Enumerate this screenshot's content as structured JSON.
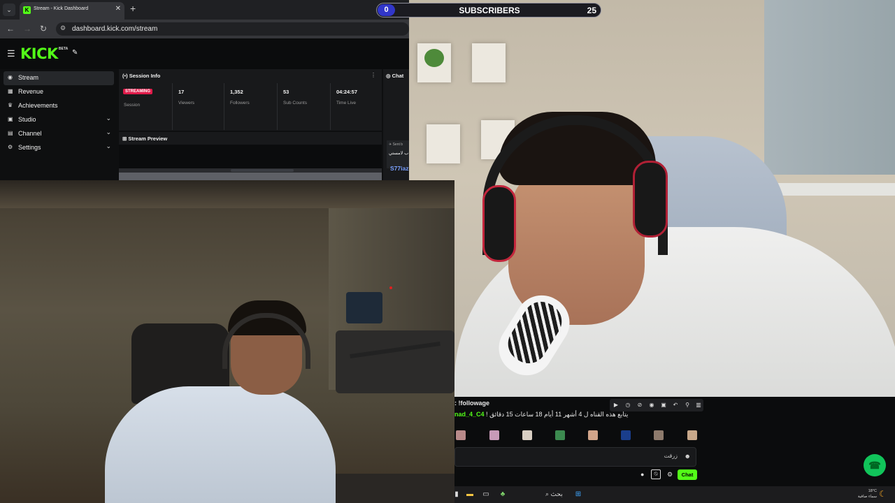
{
  "browser": {
    "tab_title": "Stream - Kick Dashboard",
    "tab_close": "✕",
    "new_tab": "+",
    "url": "dashboard.kick.com/stream"
  },
  "kick": {
    "logo": "KICK",
    "beta": "BETA",
    "sidebar": [
      {
        "label": "Stream",
        "icon": "stream-icon",
        "active": true
      },
      {
        "label": "Revenue",
        "icon": "revenue-icon"
      },
      {
        "label": "Achievements",
        "icon": "trophy-icon"
      },
      {
        "label": "Studio",
        "icon": "studio-icon",
        "chevron": true
      },
      {
        "label": "Channel",
        "icon": "channel-icon",
        "chevron": true
      },
      {
        "label": "Settings",
        "icon": "gear-icon",
        "chevron": true
      }
    ],
    "session": {
      "title": "Session Info",
      "badge": "STREAMING",
      "badge_label": "Session",
      "stats": [
        {
          "value": "17",
          "label": "Viewers"
        },
        {
          "value": "1,352",
          "label": "Followers"
        },
        {
          "value": "53",
          "label": "Sub Counts"
        },
        {
          "value": "04:24:57",
          "label": "Time Live"
        }
      ]
    },
    "preview_title": "Stream Preview",
    "chat": {
      "title": "Chat",
      "sent": "Sent b",
      "arabic": "ب لامستي",
      "user": "S77iaz"
    }
  },
  "subscribers": {
    "count": "0",
    "label": "SUBSCRIBERS",
    "goal": "25"
  },
  "kick_chat": {
    "command": ": !followage",
    "user": "nad_4_C4",
    "message": "! يتابع هذه القناه ل 4 أشهر 11 أيام 18 ساعات 15 دقائق",
    "input_text": "زرقت",
    "send_label": "Chat"
  },
  "taskbar": {
    "search": "بحث",
    "weather_temp": "18°C",
    "weather_desc": "سماء صافية"
  },
  "colors": {
    "kick_green": "#53fc18",
    "streaming_red": "#e01b4a",
    "subs_blue": "#3136c9"
  }
}
